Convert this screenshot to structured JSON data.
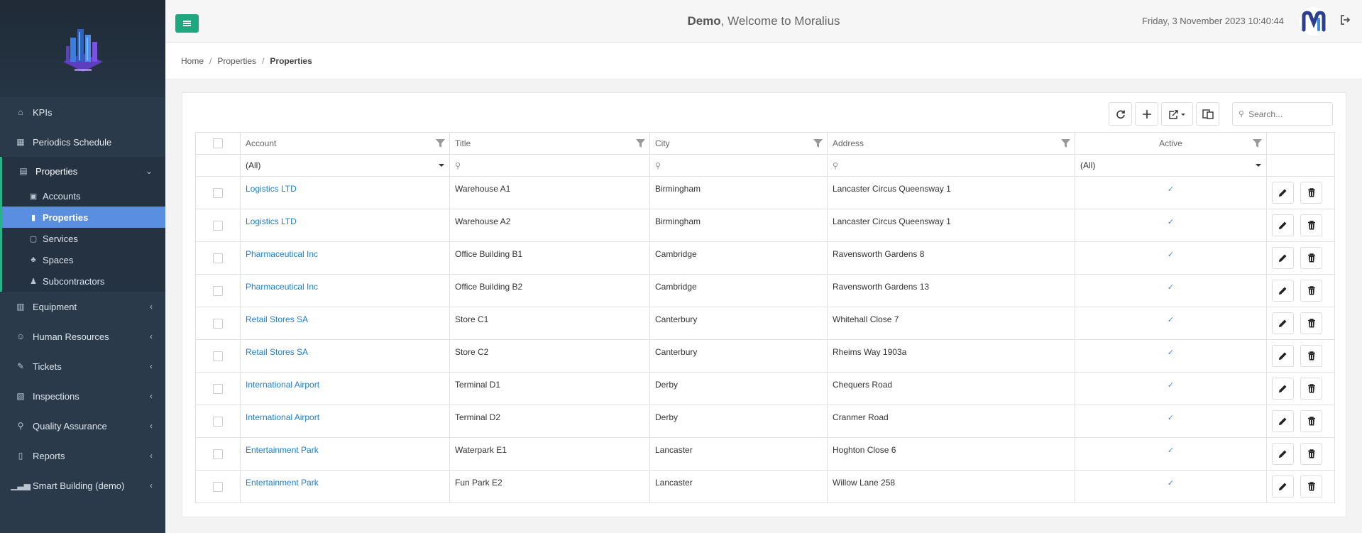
{
  "header": {
    "user": "Demo",
    "welcome_text": ", Welcome to Moralius",
    "datetime": "Friday, 3 November 2023 10:40:44"
  },
  "sidebar": {
    "items": [
      {
        "label": "KPIs",
        "icon": "home-icon"
      },
      {
        "label": "Periodics Schedule",
        "icon": "calendar-icon"
      },
      {
        "label": "Properties",
        "icon": "building-icon"
      },
      {
        "label": "Equipment",
        "icon": "equipment-icon"
      },
      {
        "label": "Human Resources",
        "icon": "users-icon"
      },
      {
        "label": "Tickets",
        "icon": "ticket-icon"
      },
      {
        "label": "Inspections",
        "icon": "map-icon"
      },
      {
        "label": "Quality Assurance",
        "icon": "search-icon"
      },
      {
        "label": "Reports",
        "icon": "book-icon"
      },
      {
        "label": "Smart Building (demo)",
        "icon": "chart-icon"
      }
    ],
    "submenu": [
      {
        "label": "Accounts",
        "icon": "accounts-icon"
      },
      {
        "label": "Properties",
        "icon": "properties-icon"
      },
      {
        "label": "Services",
        "icon": "services-icon"
      },
      {
        "label": "Spaces",
        "icon": "tree-icon"
      },
      {
        "label": "Subcontractors",
        "icon": "subcontractor-icon"
      }
    ]
  },
  "breadcrumb": {
    "home": "Home",
    "parent": "Properties",
    "current": "Properties",
    "separator": "/"
  },
  "toolbar": {
    "search_placeholder": "Search..."
  },
  "grid": {
    "columns": [
      "Account",
      "Title",
      "City",
      "Address",
      "Active"
    ],
    "filters": {
      "account": "(All)",
      "active": "(All)"
    },
    "rows": [
      {
        "account": "Logistics LTD",
        "title": "Warehouse A1",
        "city": "Birmingham",
        "address": "Lancaster Circus Queensway 1",
        "active": true
      },
      {
        "account": "Logistics LTD",
        "title": "Warehouse A2",
        "city": "Birmingham",
        "address": "Lancaster Circus Queensway 1",
        "active": true
      },
      {
        "account": "Pharmaceutical Inc",
        "title": "Office Building B1",
        "city": "Cambridge",
        "address": "Ravensworth Gardens 8",
        "active": true
      },
      {
        "account": "Pharmaceutical Inc",
        "title": "Office Building B2",
        "city": "Cambridge",
        "address": "Ravensworth Gardens 13",
        "active": true
      },
      {
        "account": "Retail Stores SA",
        "title": "Store C1",
        "city": "Canterbury",
        "address": "Whitehall Close 7",
        "active": true
      },
      {
        "account": "Retail Stores SA",
        "title": "Store C2",
        "city": "Canterbury",
        "address": "Rheims Way 1903a",
        "active": true
      },
      {
        "account": "International Airport",
        "title": "Terminal D1",
        "city": "Derby",
        "address": "Chequers Road",
        "active": true
      },
      {
        "account": "International Airport",
        "title": "Terminal D2",
        "city": "Derby",
        "address": "Cranmer Road",
        "active": true
      },
      {
        "account": "Entertainment Park",
        "title": "Waterpark E1",
        "city": "Lancaster",
        "address": "Hoghton Close 6",
        "active": true
      },
      {
        "account": "Entertainment Park",
        "title": "Fun Park E2",
        "city": "Lancaster",
        "address": "Willow Lane 258",
        "active": true
      }
    ]
  },
  "colors": {
    "sidebar_bg": "#2b3a4a",
    "accent_green": "#1fa880",
    "active_blue": "#5a8ee0",
    "link_blue": "#1a7fd4"
  }
}
